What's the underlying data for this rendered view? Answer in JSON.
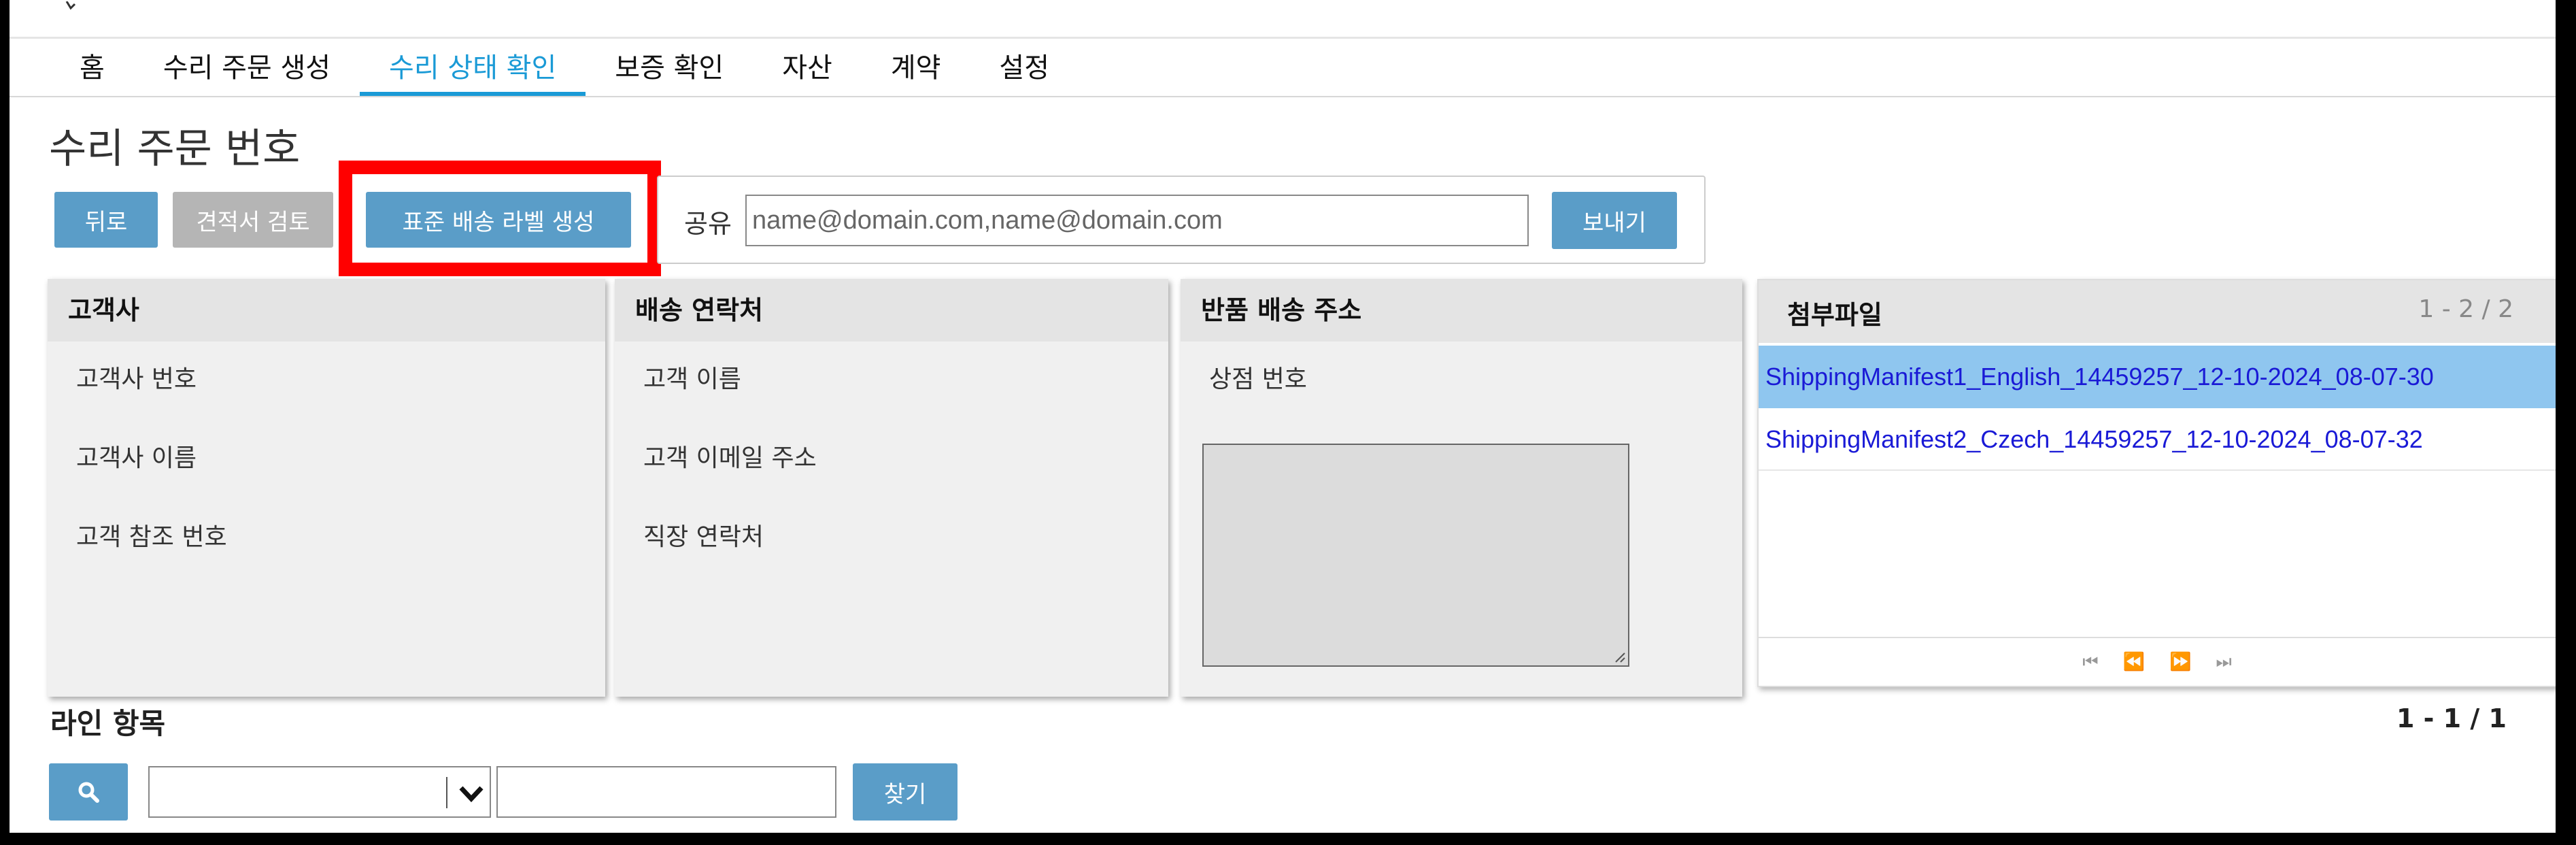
{
  "nav": {
    "tabs": [
      {
        "label": "홈"
      },
      {
        "label": "수리 주문 생성"
      },
      {
        "label": "수리 상태 확인",
        "active": true
      },
      {
        "label": "보증 확인"
      },
      {
        "label": "자산"
      },
      {
        "label": "계약"
      },
      {
        "label": "설정"
      }
    ]
  },
  "page": {
    "title": "수리 주문 번호"
  },
  "toolbar": {
    "back_label": "뒤로",
    "quote_review_label": "견적서 검토",
    "create_label_button": "표준 배송 라벨 생성",
    "share_label": "공유",
    "share_placeholder": "name@domain.com,name@domain.com",
    "send_label": "보내기"
  },
  "customer_panel": {
    "title": "고객사",
    "fields": [
      "고객사 번호",
      "고객사 이름",
      "고객 참조 번호"
    ]
  },
  "shipping_contact_panel": {
    "title": "배송 연락처",
    "fields": [
      "고객 이름",
      "고객 이메일 주소",
      "직장 연락처"
    ]
  },
  "return_address_panel": {
    "title": "반품 배송 주소",
    "fields": [
      "상점 번호"
    ]
  },
  "attachments": {
    "title": "첨부파일",
    "count": "1 - 2 / 2",
    "files": [
      "ShippingManifest1_English_14459257_12-10-2024_08-07-30",
      "ShippingManifest2_Czech_14459257_12-10-2024_08-07-32"
    ]
  },
  "line_items": {
    "title": "라인 항목",
    "count": "1 - 1 / 1",
    "find_label": "찾기",
    "select_value": "",
    "search_value": ""
  },
  "colors": {
    "accent": "#1a9ad6",
    "button": "#5a9dc8",
    "highlight": "#ff0000",
    "selected_row": "#8fc6ef"
  },
  "icons": [
    "search-icon",
    "chevron-down-icon",
    "first-page-icon",
    "prev-page-icon",
    "next-page-icon",
    "last-page-icon",
    "resize-handle-icon"
  ]
}
